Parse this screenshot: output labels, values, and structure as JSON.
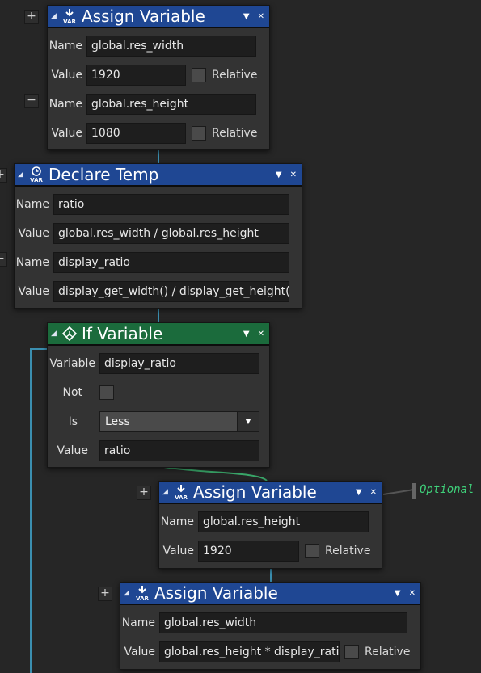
{
  "colors": {
    "canvas_bg": "#262626",
    "node_bg": "#333333",
    "action_header": "#1f4793",
    "condition_header": "#1b6b3c",
    "wire": "#3b8fb0",
    "optional_text": "#3fd17a"
  },
  "icons": {
    "collapse": "collapse-triangle-icon",
    "menu": "dropdown-triangle-icon",
    "close": "close-icon",
    "var": "var-assign-icon",
    "temp": "var-temp-clock-icon",
    "if": "if-branch-icon"
  },
  "node1": {
    "title": "Assign Variable",
    "add_btn": "+",
    "remove_btn": "−",
    "items": [
      {
        "name_label": "Name",
        "name_value": "global.res_width",
        "value_label": "Value",
        "value_value": "1920",
        "relative_label": "Relative"
      },
      {
        "name_label": "Name",
        "name_value": "global.res_height",
        "value_label": "Value",
        "value_value": "1080",
        "relative_label": "Relative"
      }
    ]
  },
  "node2": {
    "title": "Declare Temp",
    "add_btn": "+",
    "remove_btn": "−",
    "items": [
      {
        "name_label": "Name",
        "name_value": "ratio",
        "value_label": "Value",
        "value_value": "global.res_width / global.res_height"
      },
      {
        "name_label": "Name",
        "name_value": "display_ratio",
        "value_label": "Value",
        "value_value": "display_get_width() / display_get_height()"
      }
    ]
  },
  "node3": {
    "title": "If Variable",
    "variable_label": "Variable",
    "variable_value": "display_ratio",
    "not_label": "Not",
    "is_label": "Is",
    "is_value": "Less",
    "value_label": "Value",
    "value_value": "ratio"
  },
  "node4": {
    "title": "Assign Variable",
    "add_btn": "+",
    "name_label": "Name",
    "name_value": "global.res_height",
    "value_label": "Value",
    "value_value": "1920",
    "relative_label": "Relative",
    "optional_label": "Optional"
  },
  "node5": {
    "title": "Assign Variable",
    "add_btn": "+",
    "name_label": "Name",
    "name_value": "global.res_width",
    "value_label": "Value",
    "value_value": "global.res_height * display_ratio",
    "relative_label": "Relative"
  },
  "header_buttons": {
    "menu": "▼",
    "close": "✕",
    "collapse": "◢"
  }
}
